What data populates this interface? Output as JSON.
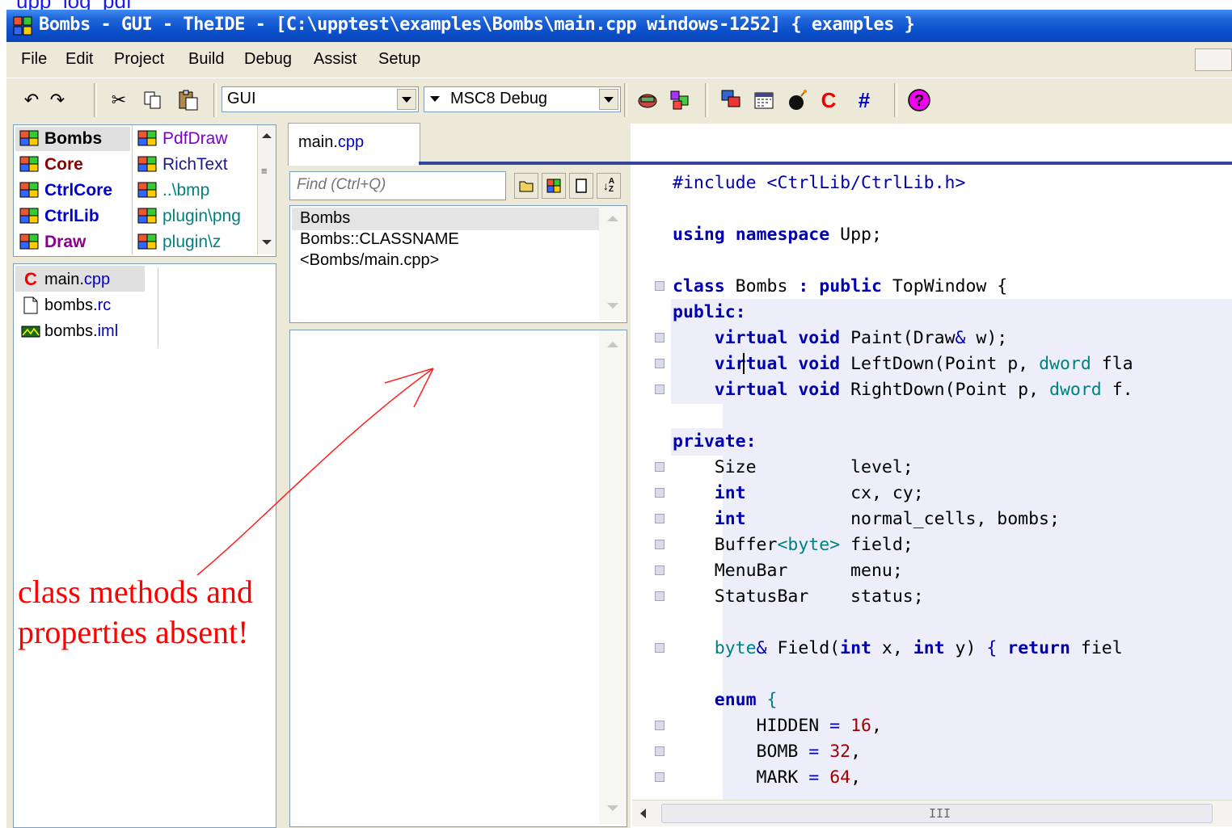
{
  "top_link": "upp_log_pdf",
  "window": {
    "title": "Bombs - GUI - TheIDE - [C:\\upptest\\examples\\Bombs\\main.cpp windows-1252] { examples }"
  },
  "menu": [
    "File",
    "Edit",
    "Project",
    "Build",
    "Debug",
    "Assist",
    "Setup"
  ],
  "toolbar": {
    "main_package": "GUI",
    "build_config": "MSC8 Debug"
  },
  "packages": {
    "col1": [
      {
        "label": "Bombs",
        "color": "#000000"
      },
      {
        "label": "Core",
        "color": "#8b0000"
      },
      {
        "label": "CtrlCore",
        "color": "#0000cc"
      },
      {
        "label": "CtrlLib",
        "color": "#0000cc"
      },
      {
        "label": "Draw",
        "color": "#8b008b"
      }
    ],
    "col2": [
      {
        "label": "PdfDraw",
        "color": "#7b00d4"
      },
      {
        "label": "RichText",
        "color": "#1a1a8a"
      },
      {
        "label": "..\\bmp",
        "color": "#008080"
      },
      {
        "label": "plugin\\png",
        "color": "#008080"
      },
      {
        "label": "plugin\\z",
        "color": "#008080"
      }
    ]
  },
  "files": [
    {
      "name": "main.",
      "ext": "cpp"
    },
    {
      "name": "bombs.",
      "ext": "rc"
    },
    {
      "name": "bombs.",
      "ext": "iml"
    }
  ],
  "tab": {
    "name": "main.",
    "ext": "cpp"
  },
  "navigator": {
    "find_placeholder": "Find (Ctrl+Q)",
    "items": [
      "Bombs",
      "Bombs::CLASSNAME",
      "<Bombs/main.cpp>"
    ]
  },
  "annotation": [
    "class methods and",
    "properties absent!"
  ],
  "code": {
    "include": "#include <CtrlLib/CtrlLib.h>",
    "using": "using namespace Upp;"
  },
  "colors": {
    "title_bar": "#0a4fcb",
    "panel": "#ece9d8",
    "annotation": "#ff0000",
    "keyword": "#0000b0"
  }
}
